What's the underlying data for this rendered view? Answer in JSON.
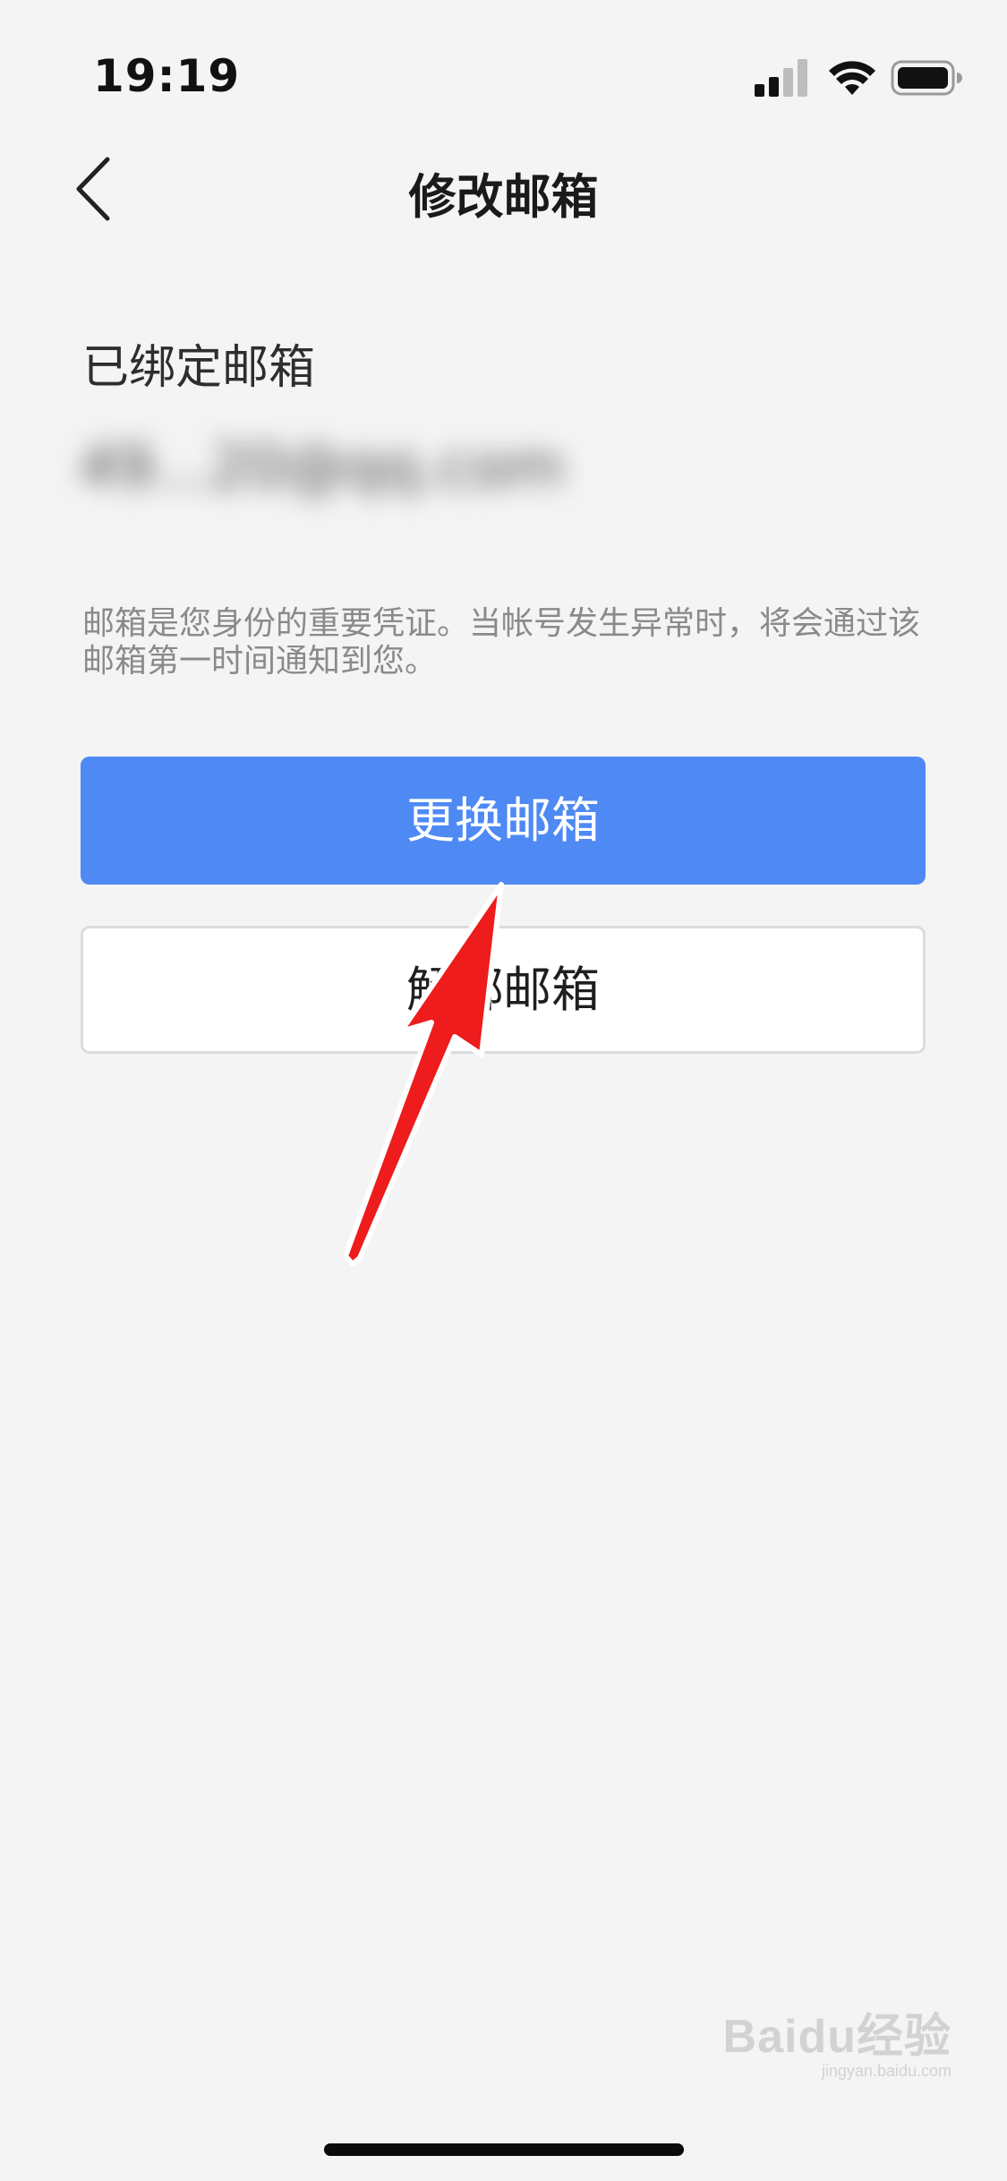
{
  "status_bar": {
    "time": "19:19",
    "icons": [
      "cellular-signal-icon",
      "wifi-icon",
      "battery-icon"
    ]
  },
  "nav": {
    "title": "修改邮箱",
    "back_icon": "chevron-left-icon"
  },
  "bound_email": {
    "label": "已绑定邮箱",
    "value": "49...20@qq.com"
  },
  "description": "邮箱是您身份的重要凭证。当帐号发生异常时，将会通过该邮箱第一时间通知到您。",
  "buttons": {
    "change_label": "更换邮箱",
    "unbind_label": "解绑邮箱"
  },
  "watermark": {
    "logo": "Baidu经验",
    "url": "jingyan.baidu.com"
  },
  "colors": {
    "primary_button": "#4e89f4",
    "annotation_arrow": "#ee1c1c",
    "background": "#f4f4f4"
  }
}
